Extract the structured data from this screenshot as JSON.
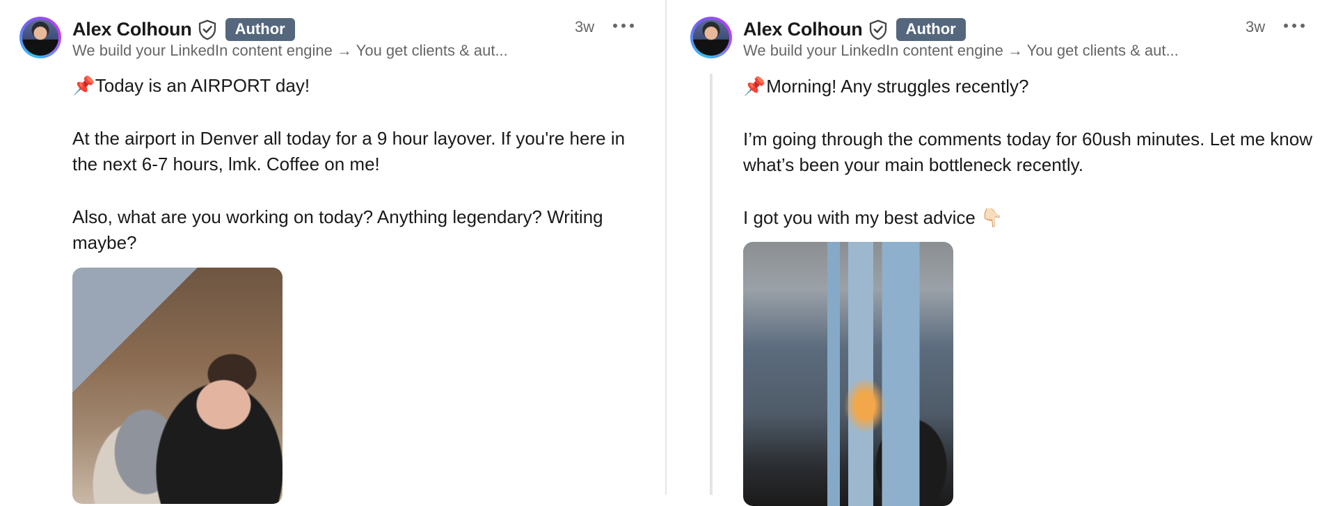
{
  "posts": [
    {
      "author": "Alex Colhoun",
      "badge": "Author",
      "subtitle": "We build your LinkedIn content engine → You get clients & aut...",
      "time": "3w",
      "paragraphs": [
        "Today is an AIRPORT day!",
        "At the airport in Denver all today for a 9 hour layover. If you're here in the next 6-7 hours, lmk. Coffee on me!",
        "Also, what are you working on today? Anything legendary? Writing maybe?"
      ],
      "icons": {
        "pin": "pushpin-icon",
        "verified": "shield-check-icon",
        "more": "more-horizontal-icon"
      }
    },
    {
      "author": "Alex Colhoun",
      "badge": "Author",
      "subtitle": "We build your LinkedIn content engine → You get clients & aut...",
      "time": "3w",
      "paragraphs": [
        "Morning! Any struggles recently?",
        "I’m going through the comments today for 60ush minutes. Let me know what’s been your main bottleneck recently.",
        "I got you with my best advice"
      ],
      "pointing_emoji": "👇🏻",
      "icons": {
        "pin": "pushpin-icon",
        "verified": "shield-check-icon",
        "more": "more-horizontal-icon"
      }
    }
  ],
  "colors": {
    "badge": "#55677d",
    "text": "#191919",
    "muted": "#666666",
    "divider": "#e6e6e6"
  }
}
